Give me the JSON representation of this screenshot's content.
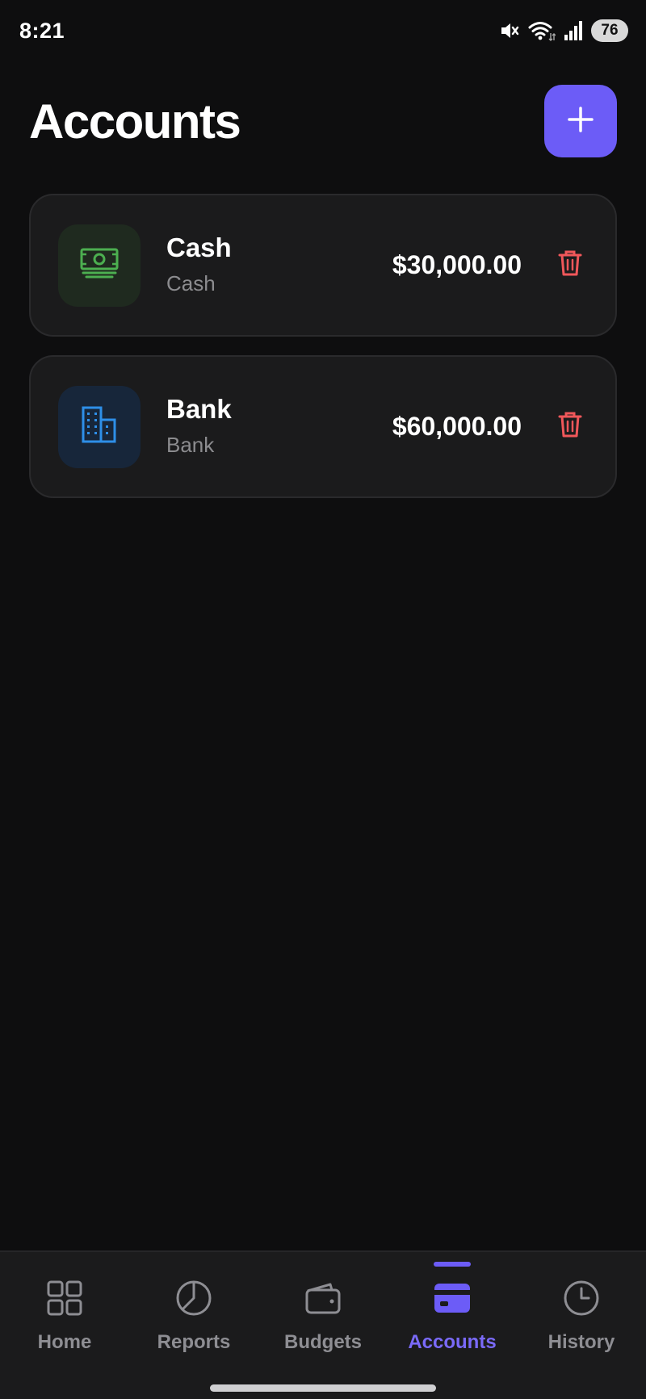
{
  "status_bar": {
    "time": "8:21",
    "battery": "76",
    "icons": [
      "mute-icon",
      "wifi-icon",
      "signal-icon",
      "battery-icon"
    ]
  },
  "header": {
    "title": "Accounts",
    "add_icon": "plus-icon"
  },
  "accounts": [
    {
      "name": "Cash",
      "type": "Cash",
      "balance": "$30,000.00",
      "icon": "cash-icon",
      "icon_color": "#4caf50",
      "tile_color": "#1f2a1f"
    },
    {
      "name": "Bank",
      "type": "Bank",
      "balance": "$60,000.00",
      "icon": "bank-building-icon",
      "icon_color": "#2e8fe8",
      "tile_color": "#17263a"
    }
  ],
  "delete_icon_color": "#f0575a",
  "accent_color": "#6c5cf7",
  "tab_bar": {
    "tabs": [
      {
        "label": "Home",
        "icon": "grid-icon",
        "active": false
      },
      {
        "label": "Reports",
        "icon": "pie-chart-icon",
        "active": false
      },
      {
        "label": "Budgets",
        "icon": "wallet-icon",
        "active": false
      },
      {
        "label": "Accounts",
        "icon": "card-icon",
        "active": true
      },
      {
        "label": "History",
        "icon": "clock-icon",
        "active": false
      }
    ]
  }
}
